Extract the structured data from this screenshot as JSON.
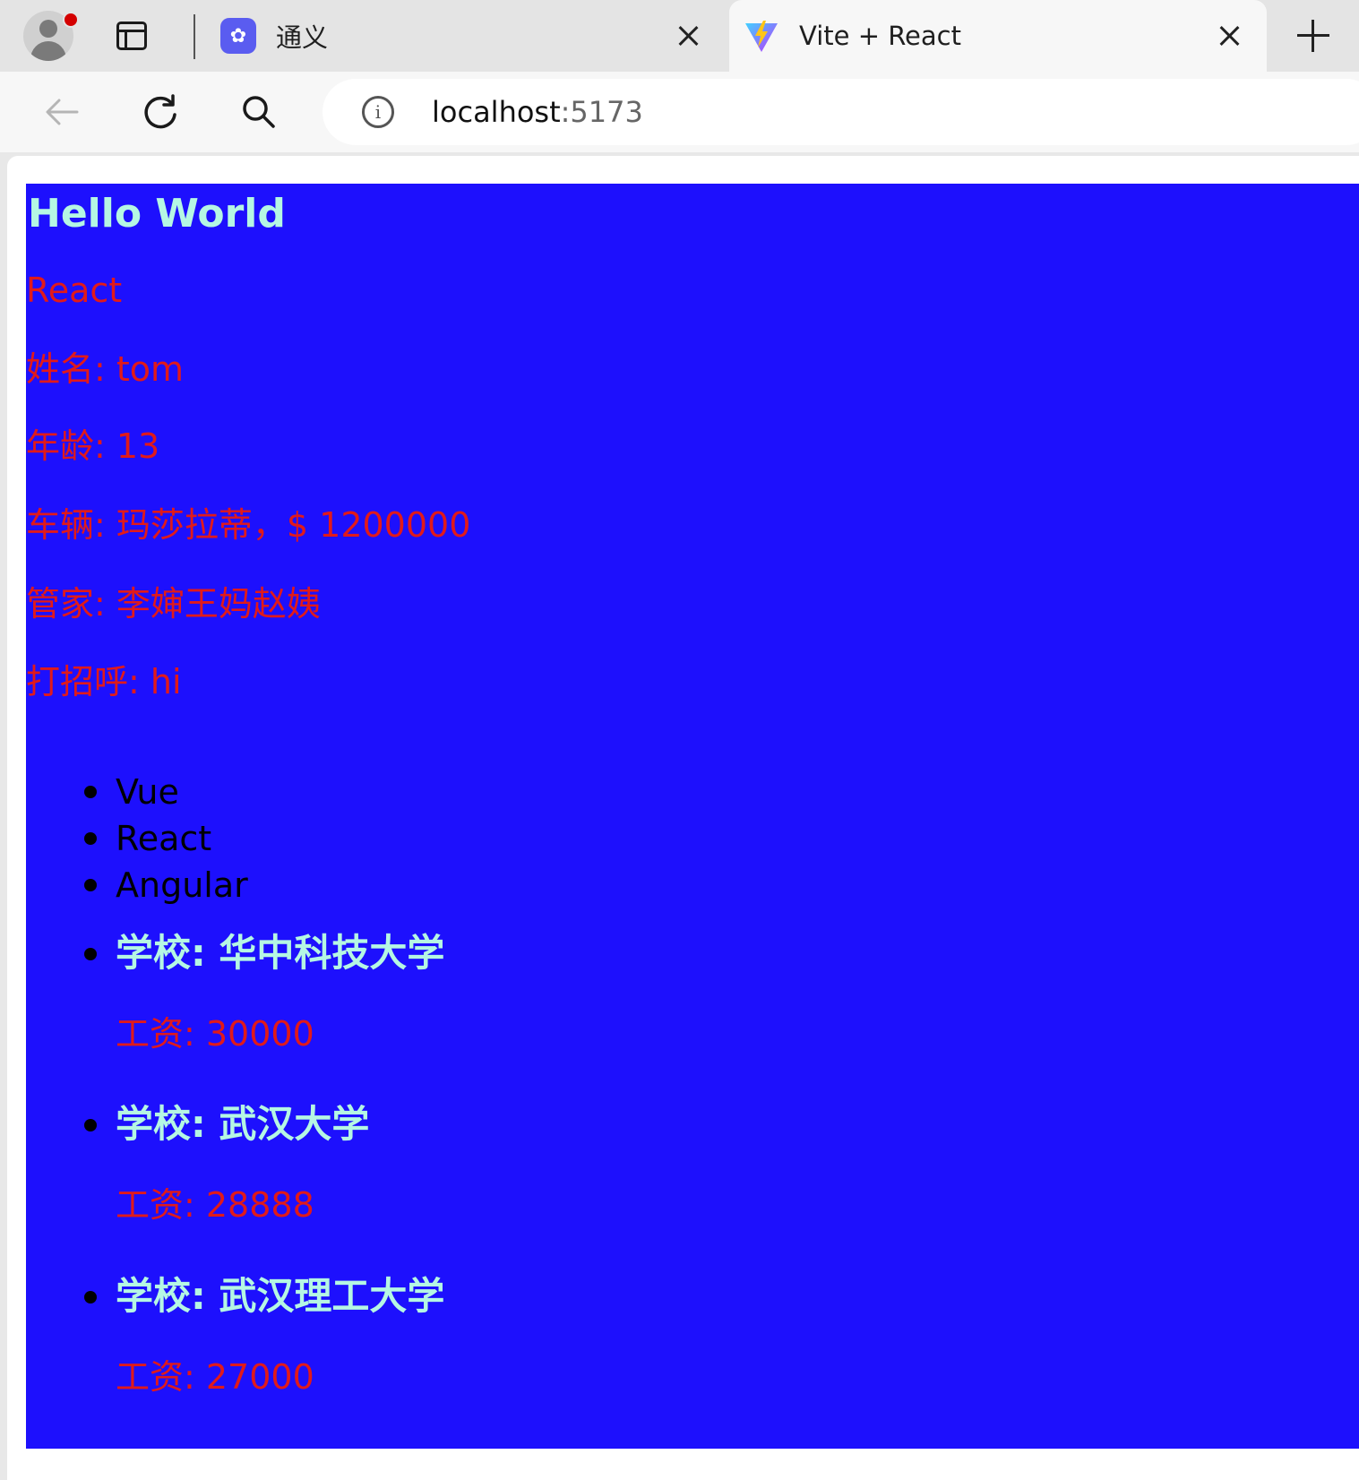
{
  "browser": {
    "tabs": [
      {
        "title": "通义",
        "icon": "tongyi-icon"
      },
      {
        "title": "Vite + React",
        "icon": "vite-icon"
      }
    ],
    "url_host": "localhost",
    "url_port": ":5173"
  },
  "page": {
    "heading": "Hello World",
    "subtitle": "React",
    "name_line": "姓名: tom",
    "age_line": "年龄: 13",
    "car_line": "车辆: 玛莎拉蒂，$ 1200000",
    "butler_line": "管家: 李婶王妈赵姨",
    "greet_line": "打招呼: hi",
    "frameworks": [
      "Vue",
      "React",
      "Angular"
    ],
    "schools": [
      {
        "name": "学校: 华中科技大学",
        "salary": "工资: 30000"
      },
      {
        "name": "学校: 武汉大学",
        "salary": "工资: 28888"
      },
      {
        "name": "学校: 武汉理工大学",
        "salary": "工资: 27000"
      }
    ]
  },
  "colors": {
    "page_background": "#1d10fd",
    "heading": "#b5f7e3",
    "text_red": "#e11a1a"
  }
}
